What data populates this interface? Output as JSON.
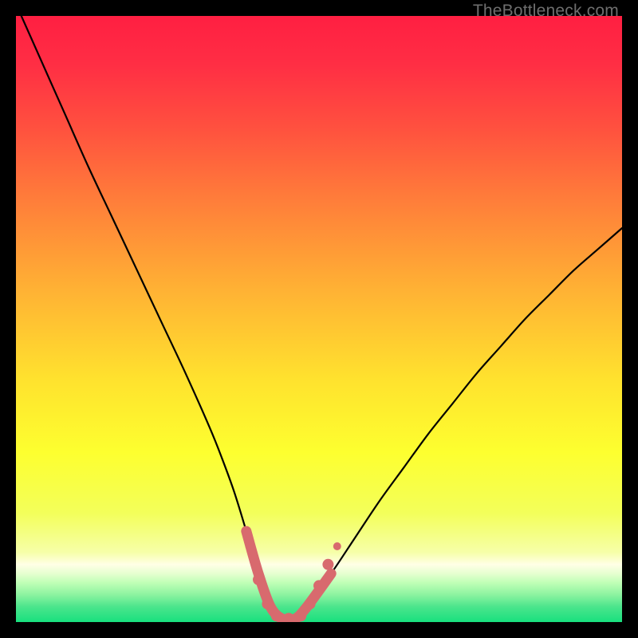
{
  "watermark": "TheBottleneck.com",
  "chart_data": {
    "type": "line",
    "title": "",
    "xlabel": "",
    "ylabel": "",
    "xlim": [
      0,
      100
    ],
    "ylim": [
      0,
      100
    ],
    "grid": false,
    "legend": false,
    "series": [
      {
        "name": "bottleneck-curve",
        "x": [
          0,
          4,
          8,
          12,
          16,
          20,
          24,
          28,
          32,
          34,
          36,
          38,
          40,
          42,
          44,
          46,
          48,
          52,
          56,
          60,
          64,
          68,
          72,
          76,
          80,
          84,
          88,
          92,
          96,
          100
        ],
        "y": [
          102,
          93,
          84,
          75,
          66.5,
          58,
          49.5,
          41,
          32,
          27,
          21.5,
          15,
          8,
          2.5,
          0.5,
          0.5,
          2.5,
          8,
          14,
          20,
          25.5,
          31,
          36,
          41,
          45.5,
          50,
          54,
          58,
          61.5,
          65
        ]
      }
    ],
    "flat_zone": {
      "x_start": 42,
      "x_end": 48,
      "y": 0.5
    },
    "markers": {
      "name": "trough-markers",
      "color": "#d86a6e",
      "points": [
        {
          "x": 38.5,
          "y": 12.5,
          "r": 5
        },
        {
          "x": 40.0,
          "y": 7.0,
          "r": 7
        },
        {
          "x": 41.5,
          "y": 3.0,
          "r": 7
        },
        {
          "x": 43.0,
          "y": 1.0,
          "r": 7
        },
        {
          "x": 45.0,
          "y": 0.6,
          "r": 7
        },
        {
          "x": 47.0,
          "y": 1.0,
          "r": 7
        },
        {
          "x": 48.5,
          "y": 3.0,
          "r": 7
        },
        {
          "x": 50.0,
          "y": 6.0,
          "r": 7
        },
        {
          "x": 51.5,
          "y": 9.5,
          "r": 7
        },
        {
          "x": 53.0,
          "y": 12.5,
          "r": 5
        }
      ]
    },
    "gradient_stops": [
      {
        "offset": 0.0,
        "color": "#ff1f42"
      },
      {
        "offset": 0.08,
        "color": "#ff2e44"
      },
      {
        "offset": 0.18,
        "color": "#ff4f3f"
      },
      {
        "offset": 0.3,
        "color": "#ff7c3a"
      },
      {
        "offset": 0.45,
        "color": "#ffb134"
      },
      {
        "offset": 0.6,
        "color": "#ffe22e"
      },
      {
        "offset": 0.72,
        "color": "#fdff2f"
      },
      {
        "offset": 0.82,
        "color": "#f3ff5a"
      },
      {
        "offset": 0.885,
        "color": "#f6ffa8"
      },
      {
        "offset": 0.905,
        "color": "#ffffe6"
      },
      {
        "offset": 0.92,
        "color": "#e6ffd0"
      },
      {
        "offset": 0.935,
        "color": "#c0ffb6"
      },
      {
        "offset": 0.955,
        "color": "#8cf3a0"
      },
      {
        "offset": 0.975,
        "color": "#4be58c"
      },
      {
        "offset": 1.0,
        "color": "#18e07e"
      }
    ]
  }
}
